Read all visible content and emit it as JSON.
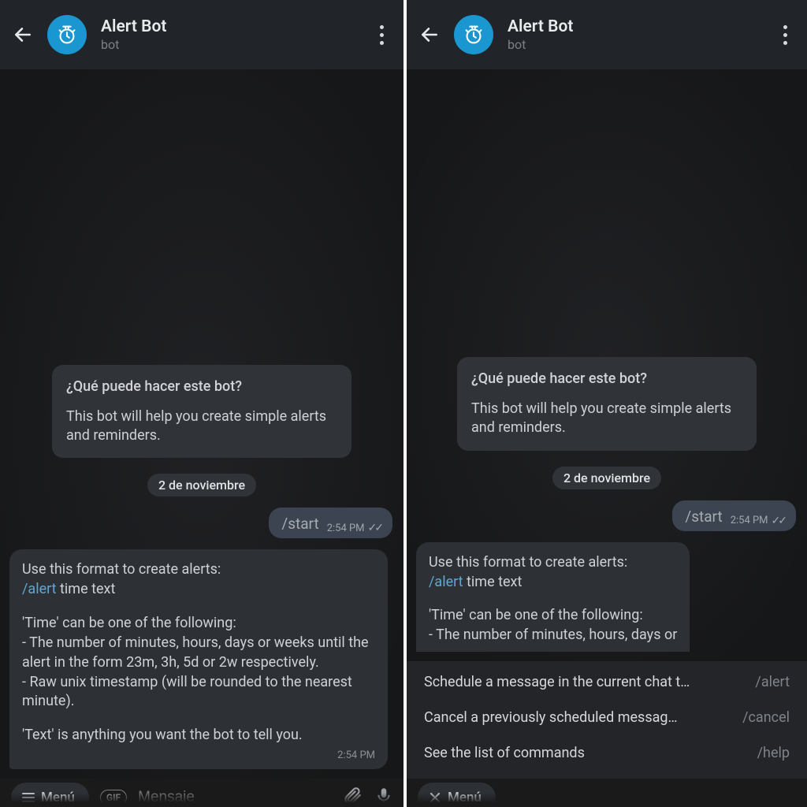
{
  "header": {
    "title": "Alert Bot",
    "subtitle": "bot"
  },
  "intro": {
    "question": "¿Qué puede hacer este bot?",
    "desc": "This bot will help you create simple alerts and reminders."
  },
  "date": "2 de noviembre",
  "outgoing": {
    "text": "/start",
    "time": "2:54 PM"
  },
  "left_in": {
    "line1": "Use this format to create alerts:",
    "cmd": "/alert",
    "after_cmd": " time text",
    "para2": "'Time' can be one of the following:\n- The number of minutes, hours, days or weeks until the alert in the form 23m, 3h, 5d or 2w respectively.\n- Raw unix timestamp (will be rounded to the nearest minute).",
    "para3": "'Text' is anything you want the bot to tell you.",
    "time": "2:54 PM"
  },
  "right_in": {
    "line1": "Use this format to create alerts:",
    "cmd": "/alert",
    "after_cmd": " time text",
    "para2": "'Time' can be one of the following:\n- The number of minutes, hours, days or"
  },
  "commands": [
    {
      "desc": "Schedule a message in the current chat t…",
      "name": "/alert"
    },
    {
      "desc": "Cancel a previously scheduled messag…",
      "name": "/cancel"
    },
    {
      "desc": "See the list of commands",
      "name": "/help"
    }
  ],
  "inputbar": {
    "menu_label": "Menú",
    "close_label": "Menú",
    "gif_label": "GIF",
    "placeholder": "Mensaje"
  }
}
